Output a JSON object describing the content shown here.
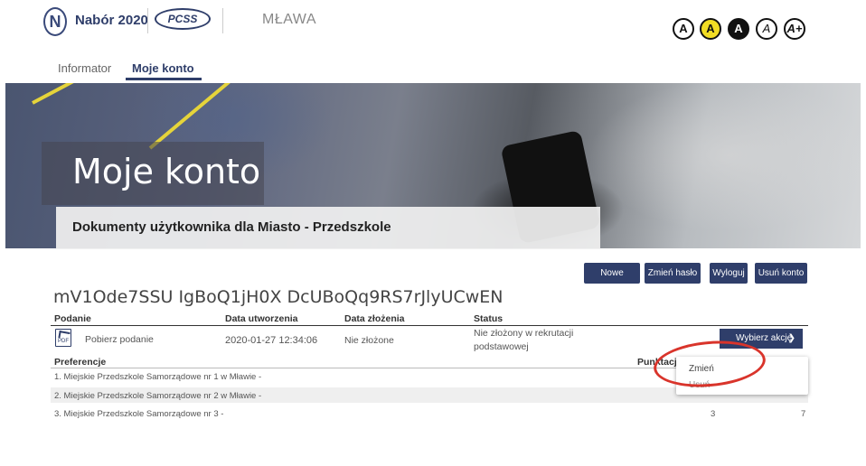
{
  "header": {
    "logo_glyph": "N",
    "brand": "Nabór 2020",
    "partner": "PCSS",
    "city": "MŁAWA",
    "contrast_options": [
      "A",
      "A",
      "A",
      "A",
      "A+"
    ]
  },
  "nav": {
    "items": [
      "Informator",
      "Moje konto"
    ],
    "active": "Moje konto"
  },
  "banner": {
    "title": "Moje konto",
    "subtitle": "Dokumenty użytkownika dla Miasto - Przedszkole"
  },
  "buttons": {
    "new": "Nowe podanie",
    "change_password": "Zmień hasło",
    "logout": "Wyloguj",
    "delete_account": "Usuń konto"
  },
  "document": {
    "id": "mV1Ode7SSU IgBoQ1jH0X DcUBoQq9RS7rJlyUCwEN",
    "columns": [
      "Podanie",
      "Data utworzenia",
      "Data złożenia",
      "Status"
    ],
    "row": {
      "icon_label": "PDF",
      "download": "Pobierz podanie",
      "created": "2020-01-27 12:34:06",
      "submitted": "Nie złożone",
      "status_line1": "Nie złożony w rekrutacji",
      "status_line2": "podstawowej",
      "action_label": "Wybierz akcję"
    }
  },
  "preferences": {
    "header": "Preferencje",
    "points_header": "Punktacja",
    "rows": [
      {
        "label": "1. Miejskie Przedszkole Samorządowe nr 1 w Mławie -",
        "a": "",
        "b": ""
      },
      {
        "label": "2. Miejskie Przedszkole Samorządowe nr 2 w Mławie -",
        "a": "",
        "b": ""
      },
      {
        "label": "3. Miejskie Przedszkole Samorządowe nr 3 -",
        "a": "3",
        "b": "7"
      }
    ]
  },
  "dropdown": {
    "items": [
      "Zmień",
      "Usuń"
    ]
  },
  "colors": {
    "primary": "#2f3e6a",
    "highlight": "#d9342b",
    "contrast_yellow": "#f2dd24"
  }
}
